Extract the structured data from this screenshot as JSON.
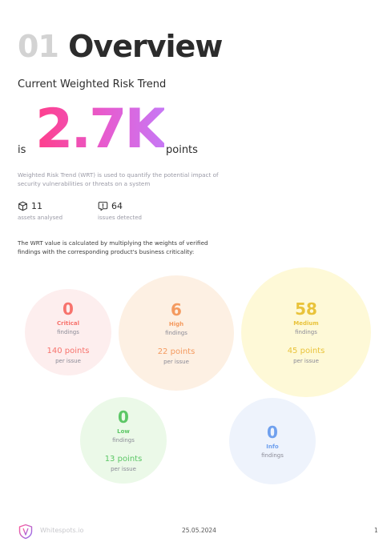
{
  "header": {
    "section_number": "01",
    "title": "Overview"
  },
  "risk": {
    "subtitle": "Current Weighted Risk Trend",
    "prefix": "is",
    "value": "2.7K",
    "suffix": "points",
    "description": "Weighted Risk Trend (WRT) is used to quantify the potential impact of security vulnerabilities or threats on a system"
  },
  "stats": [
    {
      "value": "11",
      "label": "assets analysed",
      "icon": "cube-icon"
    },
    {
      "value": "64",
      "label": "issues detected",
      "icon": "alert-icon"
    }
  ],
  "explanation": "The WRT value is calculated by multiplying the weights of verified findings with the corresponding product's business criticality:",
  "severities": [
    {
      "count": "0",
      "name": "Critical",
      "findings_label": "findings",
      "points": "140 points",
      "per_issue": "per issue",
      "color": "#f7736d",
      "bg": "#fdeeee"
    },
    {
      "count": "6",
      "name": "High",
      "findings_label": "findings",
      "points": "22 points",
      "per_issue": "per issue",
      "color": "#f49a5f",
      "bg": "#fdf0e3"
    },
    {
      "count": "58",
      "name": "Medium",
      "findings_label": "findings",
      "points": "45 points",
      "per_issue": "per issue",
      "color": "#e9c33a",
      "bg": "#fef9d7"
    },
    {
      "count": "0",
      "name": "Low",
      "findings_label": "findings",
      "points": "13 points",
      "per_issue": "per issue",
      "color": "#5cc766",
      "bg": "#ebf9e8"
    },
    {
      "count": "0",
      "name": "Info",
      "findings_label": "findings",
      "color": "#6fa0ee",
      "bg": "#eef3fc"
    }
  ],
  "footer": {
    "brand": "Whitespots.io",
    "date": "25.05.2024",
    "page": "1",
    "logo_icon": "shield-logo-icon"
  }
}
